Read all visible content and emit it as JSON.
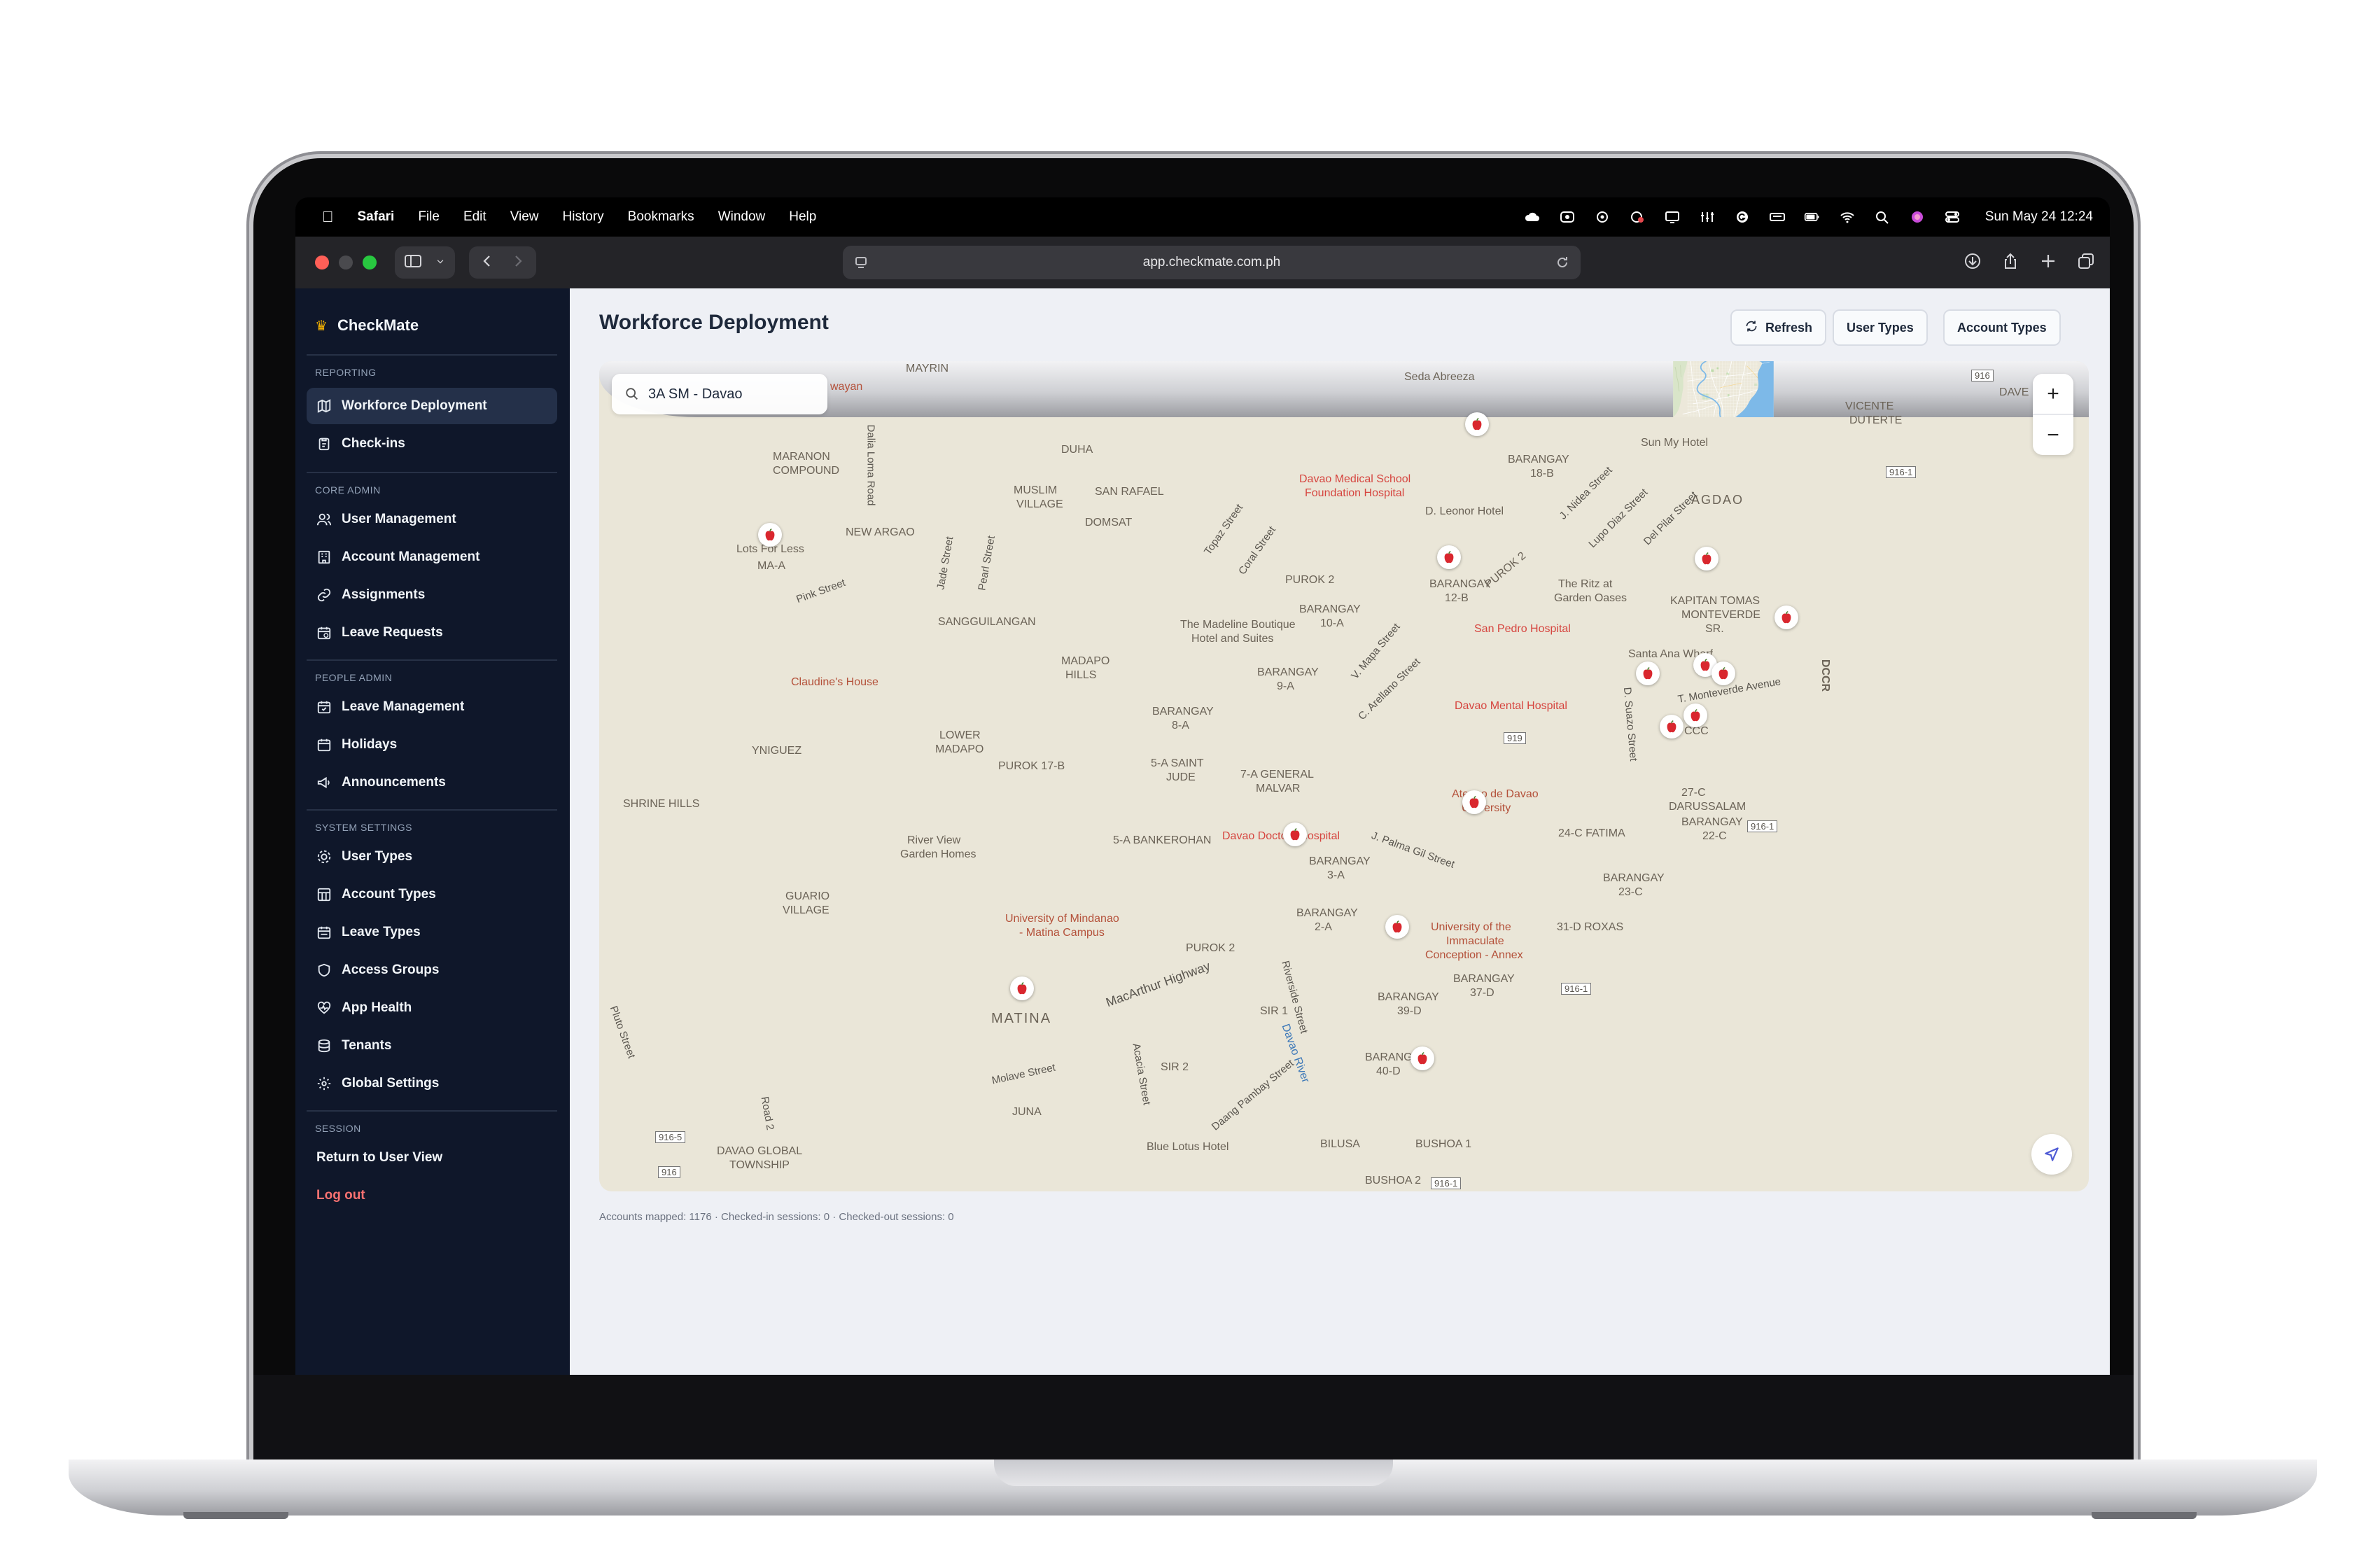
{
  "menubar": {
    "app": "Safari",
    "menus": [
      "File",
      "Edit",
      "View",
      "History",
      "Bookmarks",
      "Window",
      "Help"
    ],
    "datetime": "Sun May 24  12:24",
    "status_icons": [
      "icloud-icon",
      "creative-cloud-icon",
      "openai-icon",
      "screen-record-icon",
      "cast-icon",
      "tools-icon",
      "grammarly-icon",
      "keyboard-icon",
      "battery-icon",
      "wifi-icon",
      "spotlight-icon",
      "siri-icon",
      "control-center-icon"
    ]
  },
  "browser": {
    "url": "app.checkmate.com.ph"
  },
  "sidebar": {
    "brand": "CheckMate",
    "sections": [
      {
        "title": "REPORTING",
        "items": [
          {
            "label": "Workforce Deployment",
            "icon": "map-icon",
            "active": true
          },
          {
            "label": "Check-ins",
            "icon": "clipboard-icon"
          }
        ]
      },
      {
        "title": "CORE ADMIN",
        "items": [
          {
            "label": "User Management",
            "icon": "users-icon"
          },
          {
            "label": "Account Management",
            "icon": "building-icon"
          },
          {
            "label": "Assignments",
            "icon": "link-icon"
          },
          {
            "label": "Leave Requests",
            "icon": "calendar-clock-icon"
          }
        ]
      },
      {
        "title": "PEOPLE ADMIN",
        "items": [
          {
            "label": "Leave Management",
            "icon": "calendar-check-icon"
          },
          {
            "label": "Holidays",
            "icon": "calendar-icon"
          },
          {
            "label": "Announcements",
            "icon": "megaphone-icon"
          }
        ]
      },
      {
        "title": "SYSTEM SETTINGS",
        "items": [
          {
            "label": "User Types",
            "icon": "user-cog-icon"
          },
          {
            "label": "Account Types",
            "icon": "grid-icon"
          },
          {
            "label": "Leave Types",
            "icon": "calendar-range-icon"
          },
          {
            "label": "Access Groups",
            "icon": "shield-icon"
          },
          {
            "label": "App Health",
            "icon": "heart-pulse-icon"
          },
          {
            "label": "Tenants",
            "icon": "database-icon"
          },
          {
            "label": "Global Settings",
            "icon": "gear-icon"
          }
        ]
      },
      {
        "title": "SESSION",
        "items": [
          {
            "label": "Return to User View"
          },
          {
            "label": "Log out"
          }
        ]
      }
    ]
  },
  "main": {
    "title": "Workforce Deployment",
    "buttons": {
      "refresh": "Refresh",
      "user_types": "User Types",
      "account_types": "Account Types"
    },
    "map": {
      "search_value": "3A SM - Davao",
      "zoom_in": "+",
      "zoom_out": "−",
      "labels": {
        "seda": "Seda Abreeza",
        "mayrin": "MAYRIN",
        "wayan": "wayan",
        "duha": "DUHA",
        "maranon": "MARANON",
        "compound": "COMPOUND",
        "lots": "Lots For Less",
        "maa": "MA-A",
        "muslim": "MUSLIM",
        "village": "VILLAGE",
        "sanrafael": "SAN RAFAEL",
        "domsat": "DOMSAT",
        "newargao": "NEW ARGAO",
        "sangguilangan": "SANGGUILANGAN",
        "pink": "Pink Street",
        "claudine": "Claudine's House",
        "madapo": "MADAPO",
        "hills": "HILLS",
        "yniguez": "YNIGUEZ",
        "lowermadapo1": "LOWER",
        "lowermadapo2": "MADAPO",
        "purok17b": "PUROK 17-B",
        "shrine": "SHRINE HILLS",
        "riverview1": "River View",
        "riverview2": "Garden Homes",
        "guario1": "GUARIO",
        "guario2": "VILLAGE",
        "umn1": "University of Mindanao",
        "umn2": "- Matina Campus",
        "matina": "MATINA",
        "macarthur": "MacArthur Highway",
        "molave": "Molave Street",
        "juna": "JUNA",
        "davaoglobal1": "DAVAO GLOBAL",
        "davaoglobal2": "TOWNSHIP",
        "bluelotus": "Blue Lotus Hotel",
        "acacia": "Acacia Street",
        "dmsf1": "Davao Medical School",
        "dmsf2": "Foundation Hospital",
        "dleonor": "D. Leonor Hotel",
        "purok2": "PUROK 2",
        "barangay10a1": "BARANGAY",
        "barangay10a2": "10-A",
        "madeline1": "The Madeline Boutique",
        "madeline2": "Hotel and Suites",
        "barangay9a1": "BARANGAY",
        "barangay9a2": "9-A",
        "barangay8a1": "BARANGAY",
        "barangay8a2": "8-A",
        "saintjude1": "5-A SAINT",
        "saintjude2": "JUDE",
        "generalmalvar1": "7-A GENERAL",
        "generalmalvar2": "MALVAR",
        "bankerohan": "5-A BANKEROHAN",
        "davaodoctors": "Davao Doctors Hospital",
        "barangay3a1": "BARANGAY",
        "barangay3a2": "3-A",
        "barangay2a1": "BARANGAY",
        "barangay2a2": "2-A",
        "sir1": "SIR 1",
        "sir2": "SIR 2",
        "purok2b": "PUROK 2",
        "barangay39d1": "BARANGAY",
        "barangay39d2": "39-D",
        "barangay40d1": "BARANGAY",
        "barangay40d2": "40-D",
        "bilusa": "BILUSA",
        "bushoa1": "BUSHOA 1",
        "bushoa2": "BUSHOA 2",
        "sunmy": "Sun My Hotel",
        "barangay18b1": "BARANGAY",
        "barangay18b2": "18-B",
        "barangay12b1": "BARANGAY",
        "barangay12b2": "12-B",
        "ritz1": "The Ritz at",
        "ritz2": "Garden Oases",
        "sanpedro": "San Pedro Hospital",
        "davaomental": "Davao Mental Hospital",
        "agdao": "AGDAO",
        "kapitan1": "KAPITAN TOMAS",
        "kapitan2": "MONTEVERDE",
        "kapitan3": "SR.",
        "santaana": "Santa Ana Wharf",
        "monteverde": "T. Monteverde Avenue",
        "addu1": "Ateneo de Davao",
        "addu2": "University",
        "fatima": "24-C FATIMA",
        "darussalam1": "27-C",
        "darussalam2": "DARUSSALAM",
        "barangay22c1": "BARANGAY",
        "barangay22c2": "22-C",
        "barangay23c1": "BARANGAY",
        "barangay23c2": "23-C",
        "roxas": "31-D ROXAS",
        "uic1": "University of the",
        "uic2": "Immaculate",
        "uic3": "Conception - Annex",
        "barangay37d1": "BARANGAY",
        "barangay37d2": "37-D",
        "vicente1": "VICENTE",
        "vicente2": "DUTERTE",
        "dave": "DAVE",
        "dccr": "DCCR",
        "ccc": "CCC",
        "purok2c": "PUROK 2",
        "dalialoma": "Dalia Loma Road",
        "jade": "Jade Street",
        "pearl": "Pearl Street",
        "topaz": "Topaz Street",
        "coral": "Coral Street",
        "mapa": "V. Mapa Street",
        "arellano": "C. Arellano Street",
        "jpalma": "J. Palma Gil Street",
        "nidea": "J. Nidea Street",
        "lupodiaz": "Lupo Diaz Street",
        "delpilar": "Del Pilar Street",
        "quezon": "D. Suazo Street",
        "riverside": "Riverside Street",
        "daang": "Daang Pambay Street",
        "road2": "Road 2",
        "pluto": "Pluto Street",
        "dvs": "Davao River",
        "r916a": "916-1",
        "r916b": "916-1",
        "r916c": "916-1",
        "r916d": "916-1",
        "r916e": "916-5",
        "r916f": "916",
        "r916g": "916-1",
        "r919": "919",
        "r916h": "916"
      }
    },
    "status": "Accounts mapped: 1176 · Checked-in sessions: 0 · Checked-out sessions: 0"
  },
  "colors": {
    "sidebar_bg": "#0f172a",
    "sidebar_active": "#243049",
    "logout": "#f87171",
    "water": "#7db9e8",
    "accent_pin": "#d9272e"
  }
}
